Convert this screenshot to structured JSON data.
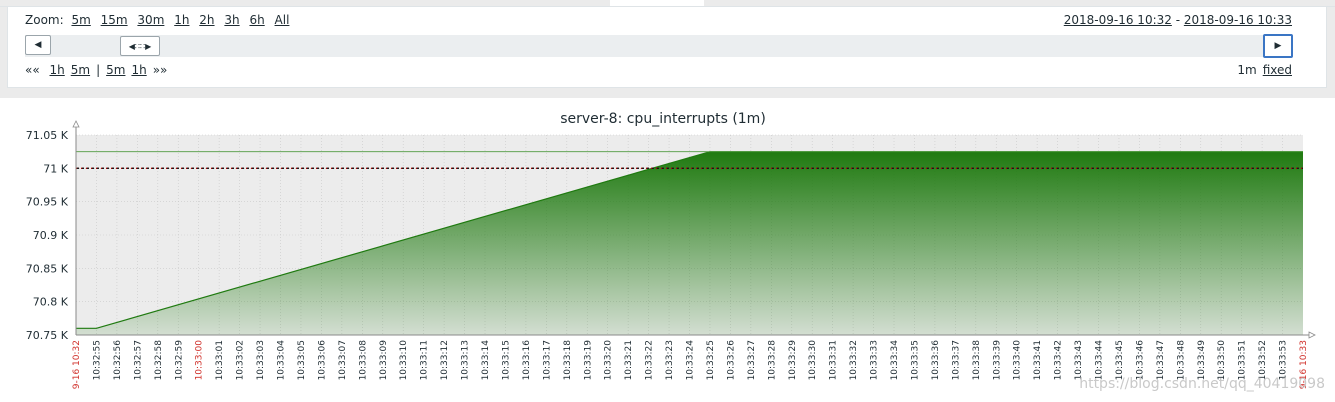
{
  "zoom": {
    "label": "Zoom:",
    "options": [
      "5m",
      "15m",
      "30m",
      "1h",
      "2h",
      "3h",
      "6h",
      "All"
    ]
  },
  "period": {
    "from": "2018-09-16 10:32",
    "separator": " - ",
    "to": "2018-09-16 10:33"
  },
  "navigation": {
    "back": "«« ",
    "back_steps": [
      "1h",
      "5m"
    ],
    "separator": "|",
    "forward_steps": [
      "5m",
      "1h"
    ],
    "forward": "»»",
    "period_length": "1m",
    "fixed_label": "fixed"
  },
  "icons": {
    "scroll_left": "triangle-left-icon",
    "scroll_right": "triangle-right-icon",
    "scroll_handle": "handle-grip-icon"
  },
  "colors": {
    "series_fill": "#1f7a10",
    "trigger_line": "#b00000",
    "time_marker": "#d0302a",
    "plot_bg": "#ececec"
  },
  "watermark": "https://blog.csdn.net/qq_40419098",
  "chart_data": {
    "type": "area",
    "title": "server-8: cpu_interrupts (1m)",
    "y_ticks": [
      "70.75 K",
      "70.8 K",
      "70.85 K",
      "70.9 K",
      "70.95 K",
      "71 K",
      "71.05 K"
    ],
    "ylim": [
      70750,
      71050
    ],
    "x_start_label": "9-16 10:32",
    "x_end_label": "9-16 10:33",
    "x_mid_label": "10:33:00",
    "x_labels": [
      "10:32:55",
      "10:32:56",
      "10:32:57",
      "10:32:58",
      "10:32:59",
      "10:33:00",
      "10:33:01",
      "10:33:02",
      "10:33:03",
      "10:33:04",
      "10:33:05",
      "10:33:06",
      "10:33:07",
      "10:33:08",
      "10:33:09",
      "10:33:10",
      "10:33:11",
      "10:33:12",
      "10:33:13",
      "10:33:14",
      "10:33:15",
      "10:33:16",
      "10:33:17",
      "10:33:18",
      "10:33:19",
      "10:33:20",
      "10:33:21",
      "10:33:22",
      "10:33:23",
      "10:33:24",
      "10:33:25",
      "10:33:26",
      "10:33:27",
      "10:33:28",
      "10:33:29",
      "10:33:30",
      "10:33:31",
      "10:33:32",
      "10:33:33",
      "10:33:34",
      "10:33:35",
      "10:33:36",
      "10:33:37",
      "10:33:38",
      "10:33:39",
      "10:33:40",
      "10:33:41",
      "10:33:42",
      "10:33:43",
      "10:33:44",
      "10:33:45",
      "10:33:46",
      "10:33:47",
      "10:33:48",
      "10:33:49",
      "10:33:50",
      "10:33:51",
      "10:33:52",
      "10:33:53"
    ],
    "series": [
      {
        "values_x_seconds": [
          54,
          55,
          85,
          114
        ],
        "values_y": [
          70760,
          70760,
          71025,
          71025
        ]
      }
    ],
    "max_line": 71025,
    "trigger_value": 71000,
    "x_range_seconds": [
      54,
      114
    ]
  }
}
